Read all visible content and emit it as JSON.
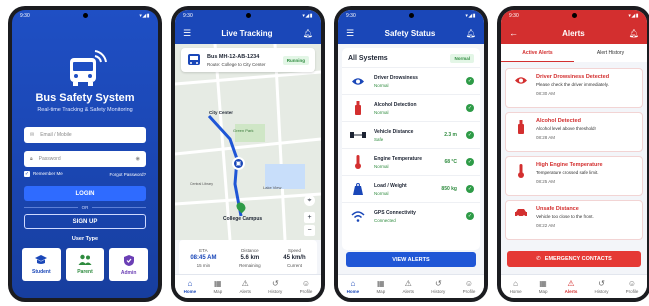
{
  "status_time": "9:30",
  "login": {
    "title": "Bus Safety System",
    "subtitle": "Real-time Tracking & Safety Monitoring",
    "email_placeholder": "Email / Mobile",
    "password_placeholder": "Password",
    "remember": "Remember Me",
    "forgot": "Forgot Password?",
    "login_btn": "LOGIN",
    "or": "OR",
    "signup_btn": "SIGN UP",
    "user_type_label": "User Type",
    "user_types": [
      "Student",
      "Parent",
      "Admin"
    ]
  },
  "tracking": {
    "title": "Live Tracking",
    "bus_id": "Bus MH-12-AB-1234",
    "route": "Route: College to City Center",
    "status": "Running",
    "map_labels": {
      "city_center": "City Center",
      "green_park": "Green Park",
      "central_library": "Central Library",
      "lake_view": "Lake View",
      "college": "College Campus"
    },
    "eta_label": "ETA",
    "eta_value": "08:45 AM",
    "eta_sub": "15 min",
    "distance_label": "Distance",
    "distance_value": "5.6 km",
    "distance_sub": "Remaining",
    "speed_label": "Speed",
    "speed_value": "45 km/h",
    "speed_sub": "Current"
  },
  "safety": {
    "title": "Safety Status",
    "all_systems": "All Systems",
    "overall": "Normal",
    "items": [
      {
        "name": "Driver Drowsiness",
        "status": "Normal",
        "value": "",
        "icon": "eye-icon"
      },
      {
        "name": "Alcohol Detection",
        "status": "Normal",
        "value": "",
        "icon": "bottle-icon"
      },
      {
        "name": "Vehicle Distance",
        "status": "Safe",
        "value": "2.3 m",
        "icon": "distance-icon"
      },
      {
        "name": "Engine Temperature",
        "status": "Normal",
        "value": "68 °C",
        "icon": "thermometer-icon"
      },
      {
        "name": "Load / Weight",
        "status": "Normal",
        "value": "850 kg",
        "icon": "weight-icon"
      },
      {
        "name": "GPS Connectivity",
        "status": "Connected",
        "value": "",
        "icon": "wifi-icon"
      }
    ],
    "view_alerts_btn": "VIEW ALERTS"
  },
  "alerts": {
    "title": "Alerts",
    "tab_active": "Active Alerts",
    "tab_history": "Alert History",
    "items": [
      {
        "title": "Driver Drowsiness Detected",
        "desc": "Please check the driver immediately.",
        "time": "08:30 AM"
      },
      {
        "title": "Alcohol Detected",
        "desc": "Alcohol level above threshold!",
        "time": "08:28 AM"
      },
      {
        "title": "High Engine Temperature",
        "desc": "Temperature crossed safe limit.",
        "time": "08:25 AM"
      },
      {
        "title": "Unsafe Distance",
        "desc": "Vehicle too close to the front.",
        "time": "08:22 AM"
      }
    ],
    "emergency_btn": "EMERGENCY CONTACTS"
  },
  "nav": [
    "Home",
    "Map",
    "Alerts",
    "History",
    "Profile"
  ],
  "colors": {
    "primary": "#1a47b8",
    "danger": "#d32f2f",
    "success": "#2e9b47"
  }
}
